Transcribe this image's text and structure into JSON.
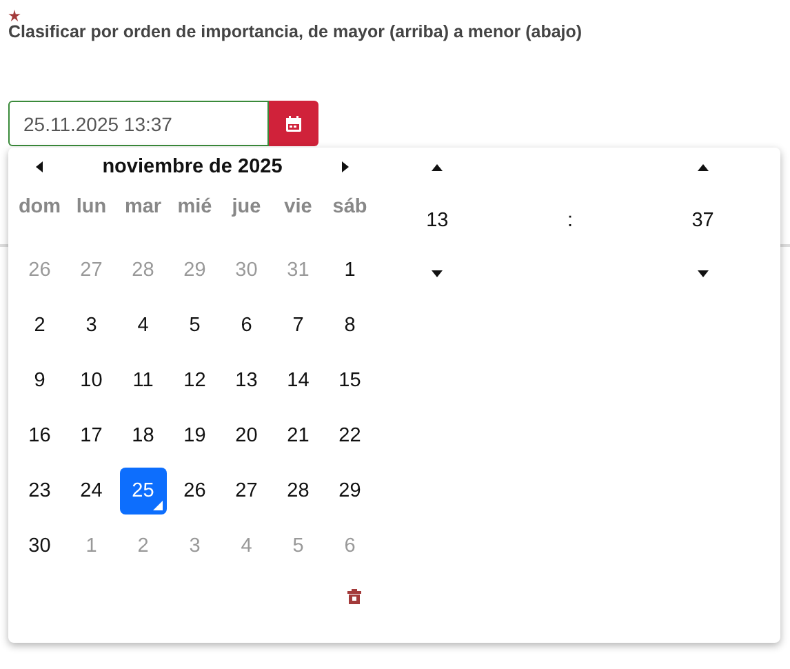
{
  "field": {
    "required": true,
    "label": "Clasificar por orden de importancia, de mayor (arriba) a menor (abajo)",
    "value": "25.11.2025 13:37"
  },
  "picker": {
    "month_title": "noviembre de 2025",
    "weekdays": [
      "dom",
      "lun",
      "mar",
      "mié",
      "jue",
      "vie",
      "sáb"
    ],
    "weeks": [
      [
        {
          "day": "26",
          "muted": true,
          "selected": false,
          "today": false
        },
        {
          "day": "27",
          "muted": true,
          "selected": false,
          "today": false
        },
        {
          "day": "28",
          "muted": true,
          "selected": false,
          "today": false
        },
        {
          "day": "29",
          "muted": true,
          "selected": false,
          "today": false
        },
        {
          "day": "30",
          "muted": true,
          "selected": false,
          "today": false
        },
        {
          "day": "31",
          "muted": true,
          "selected": false,
          "today": false
        },
        {
          "day": "1",
          "muted": false,
          "selected": false,
          "today": false
        }
      ],
      [
        {
          "day": "2",
          "muted": false,
          "selected": false,
          "today": false
        },
        {
          "day": "3",
          "muted": false,
          "selected": false,
          "today": false
        },
        {
          "day": "4",
          "muted": false,
          "selected": false,
          "today": false
        },
        {
          "day": "5",
          "muted": false,
          "selected": false,
          "today": false
        },
        {
          "day": "6",
          "muted": false,
          "selected": false,
          "today": false
        },
        {
          "day": "7",
          "muted": false,
          "selected": false,
          "today": false
        },
        {
          "day": "8",
          "muted": false,
          "selected": false,
          "today": false
        }
      ],
      [
        {
          "day": "9",
          "muted": false,
          "selected": false,
          "today": false
        },
        {
          "day": "10",
          "muted": false,
          "selected": false,
          "today": false
        },
        {
          "day": "11",
          "muted": false,
          "selected": false,
          "today": false
        },
        {
          "day": "12",
          "muted": false,
          "selected": false,
          "today": false
        },
        {
          "day": "13",
          "muted": false,
          "selected": false,
          "today": false
        },
        {
          "day": "14",
          "muted": false,
          "selected": false,
          "today": false
        },
        {
          "day": "15",
          "muted": false,
          "selected": false,
          "today": false
        }
      ],
      [
        {
          "day": "16",
          "muted": false,
          "selected": false,
          "today": false
        },
        {
          "day": "17",
          "muted": false,
          "selected": false,
          "today": false
        },
        {
          "day": "18",
          "muted": false,
          "selected": false,
          "today": false
        },
        {
          "day": "19",
          "muted": false,
          "selected": false,
          "today": false
        },
        {
          "day": "20",
          "muted": false,
          "selected": false,
          "today": false
        },
        {
          "day": "21",
          "muted": false,
          "selected": false,
          "today": false
        },
        {
          "day": "22",
          "muted": false,
          "selected": false,
          "today": false
        }
      ],
      [
        {
          "day": "23",
          "muted": false,
          "selected": false,
          "today": false
        },
        {
          "day": "24",
          "muted": false,
          "selected": false,
          "today": false
        },
        {
          "day": "25",
          "muted": false,
          "selected": true,
          "today": true
        },
        {
          "day": "26",
          "muted": false,
          "selected": false,
          "today": false
        },
        {
          "day": "27",
          "muted": false,
          "selected": false,
          "today": false
        },
        {
          "day": "28",
          "muted": false,
          "selected": false,
          "today": false
        },
        {
          "day": "29",
          "muted": false,
          "selected": false,
          "today": false
        }
      ],
      [
        {
          "day": "30",
          "muted": false,
          "selected": false,
          "today": false
        },
        {
          "day": "1",
          "muted": true,
          "selected": false,
          "today": false
        },
        {
          "day": "2",
          "muted": true,
          "selected": false,
          "today": false
        },
        {
          "day": "3",
          "muted": true,
          "selected": false,
          "today": false
        },
        {
          "day": "4",
          "muted": true,
          "selected": false,
          "today": false
        },
        {
          "day": "5",
          "muted": true,
          "selected": false,
          "today": false
        },
        {
          "day": "6",
          "muted": true,
          "selected": false,
          "today": false
        }
      ]
    ],
    "hour": "13",
    "separator": ":",
    "minute": "37"
  }
}
